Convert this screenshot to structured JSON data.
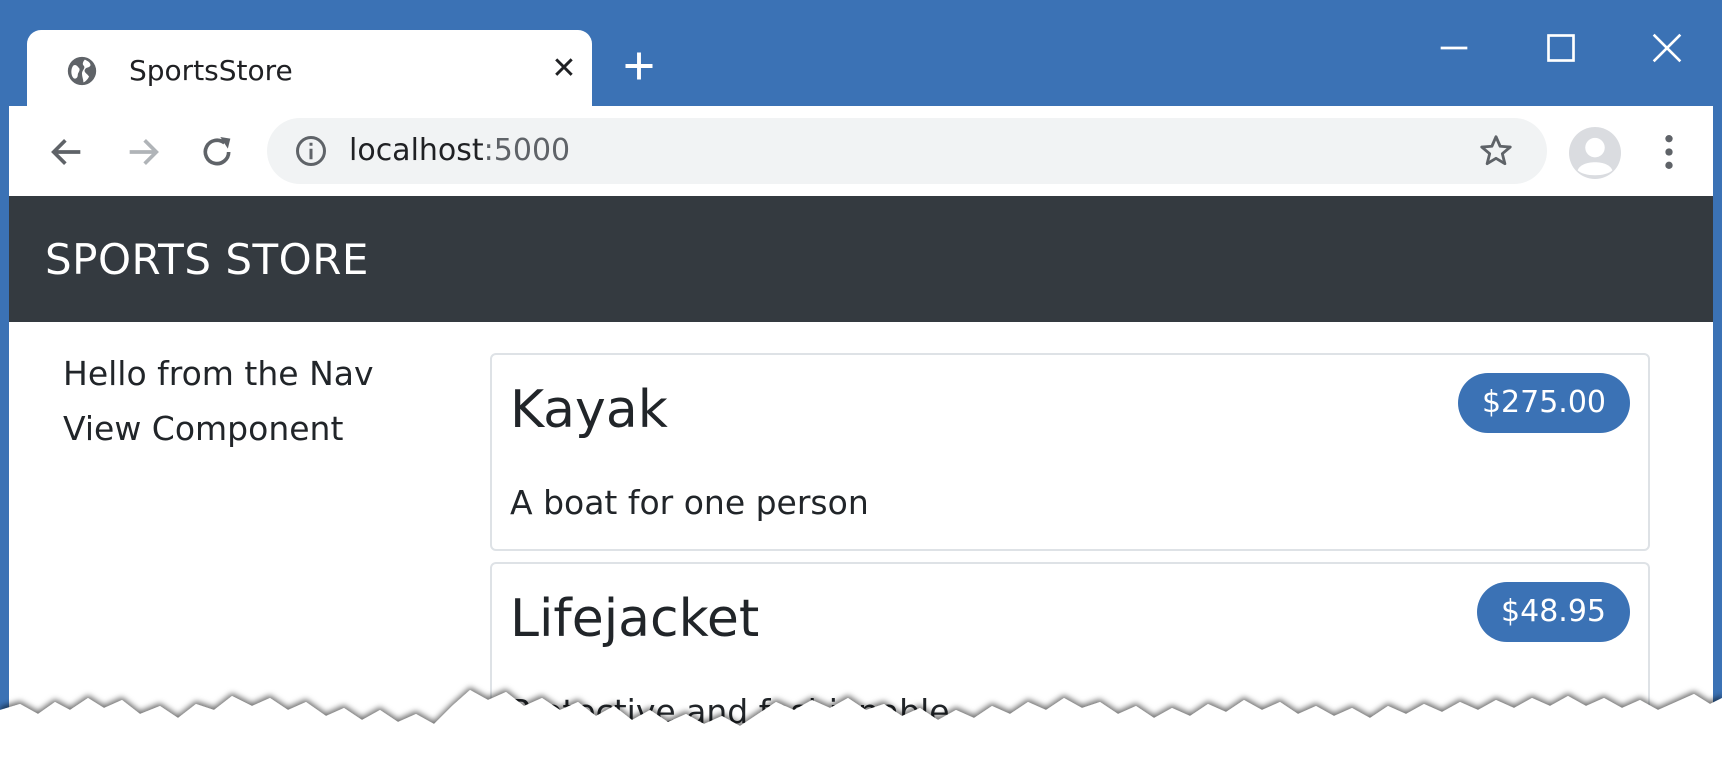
{
  "browser": {
    "tab": {
      "title": "SportsStore",
      "close_glyph": "✕",
      "icon": "globe-icon"
    },
    "new_tab_icon": "plus-icon",
    "window_controls": [
      "minimize-icon",
      "maximize-icon",
      "close-icon"
    ],
    "toolbar": {
      "back_icon": "arrow-left-icon",
      "forward_icon": "arrow-right-icon",
      "reload_icon": "reload-icon",
      "url_host": "localhost",
      "url_port": ":5000",
      "site_info_icon": "info-icon",
      "bookmark_icon": "star-icon",
      "profile_icon": "avatar-icon",
      "menu_icon": "kebab-menu-icon"
    },
    "accent_color": "#3b72b5"
  },
  "page": {
    "navbar": {
      "brand": "SPORTS STORE",
      "background": "#343a40"
    },
    "sidebar": {
      "text": "Hello from the Nav View Component"
    },
    "products": [
      {
        "name": "Kayak",
        "price": "$275.00",
        "description": "A boat for one person"
      },
      {
        "name": "Lifejacket",
        "price": "$48.95",
        "description": "Protective and fashionable"
      }
    ],
    "badge_color": "#3b72b5"
  }
}
